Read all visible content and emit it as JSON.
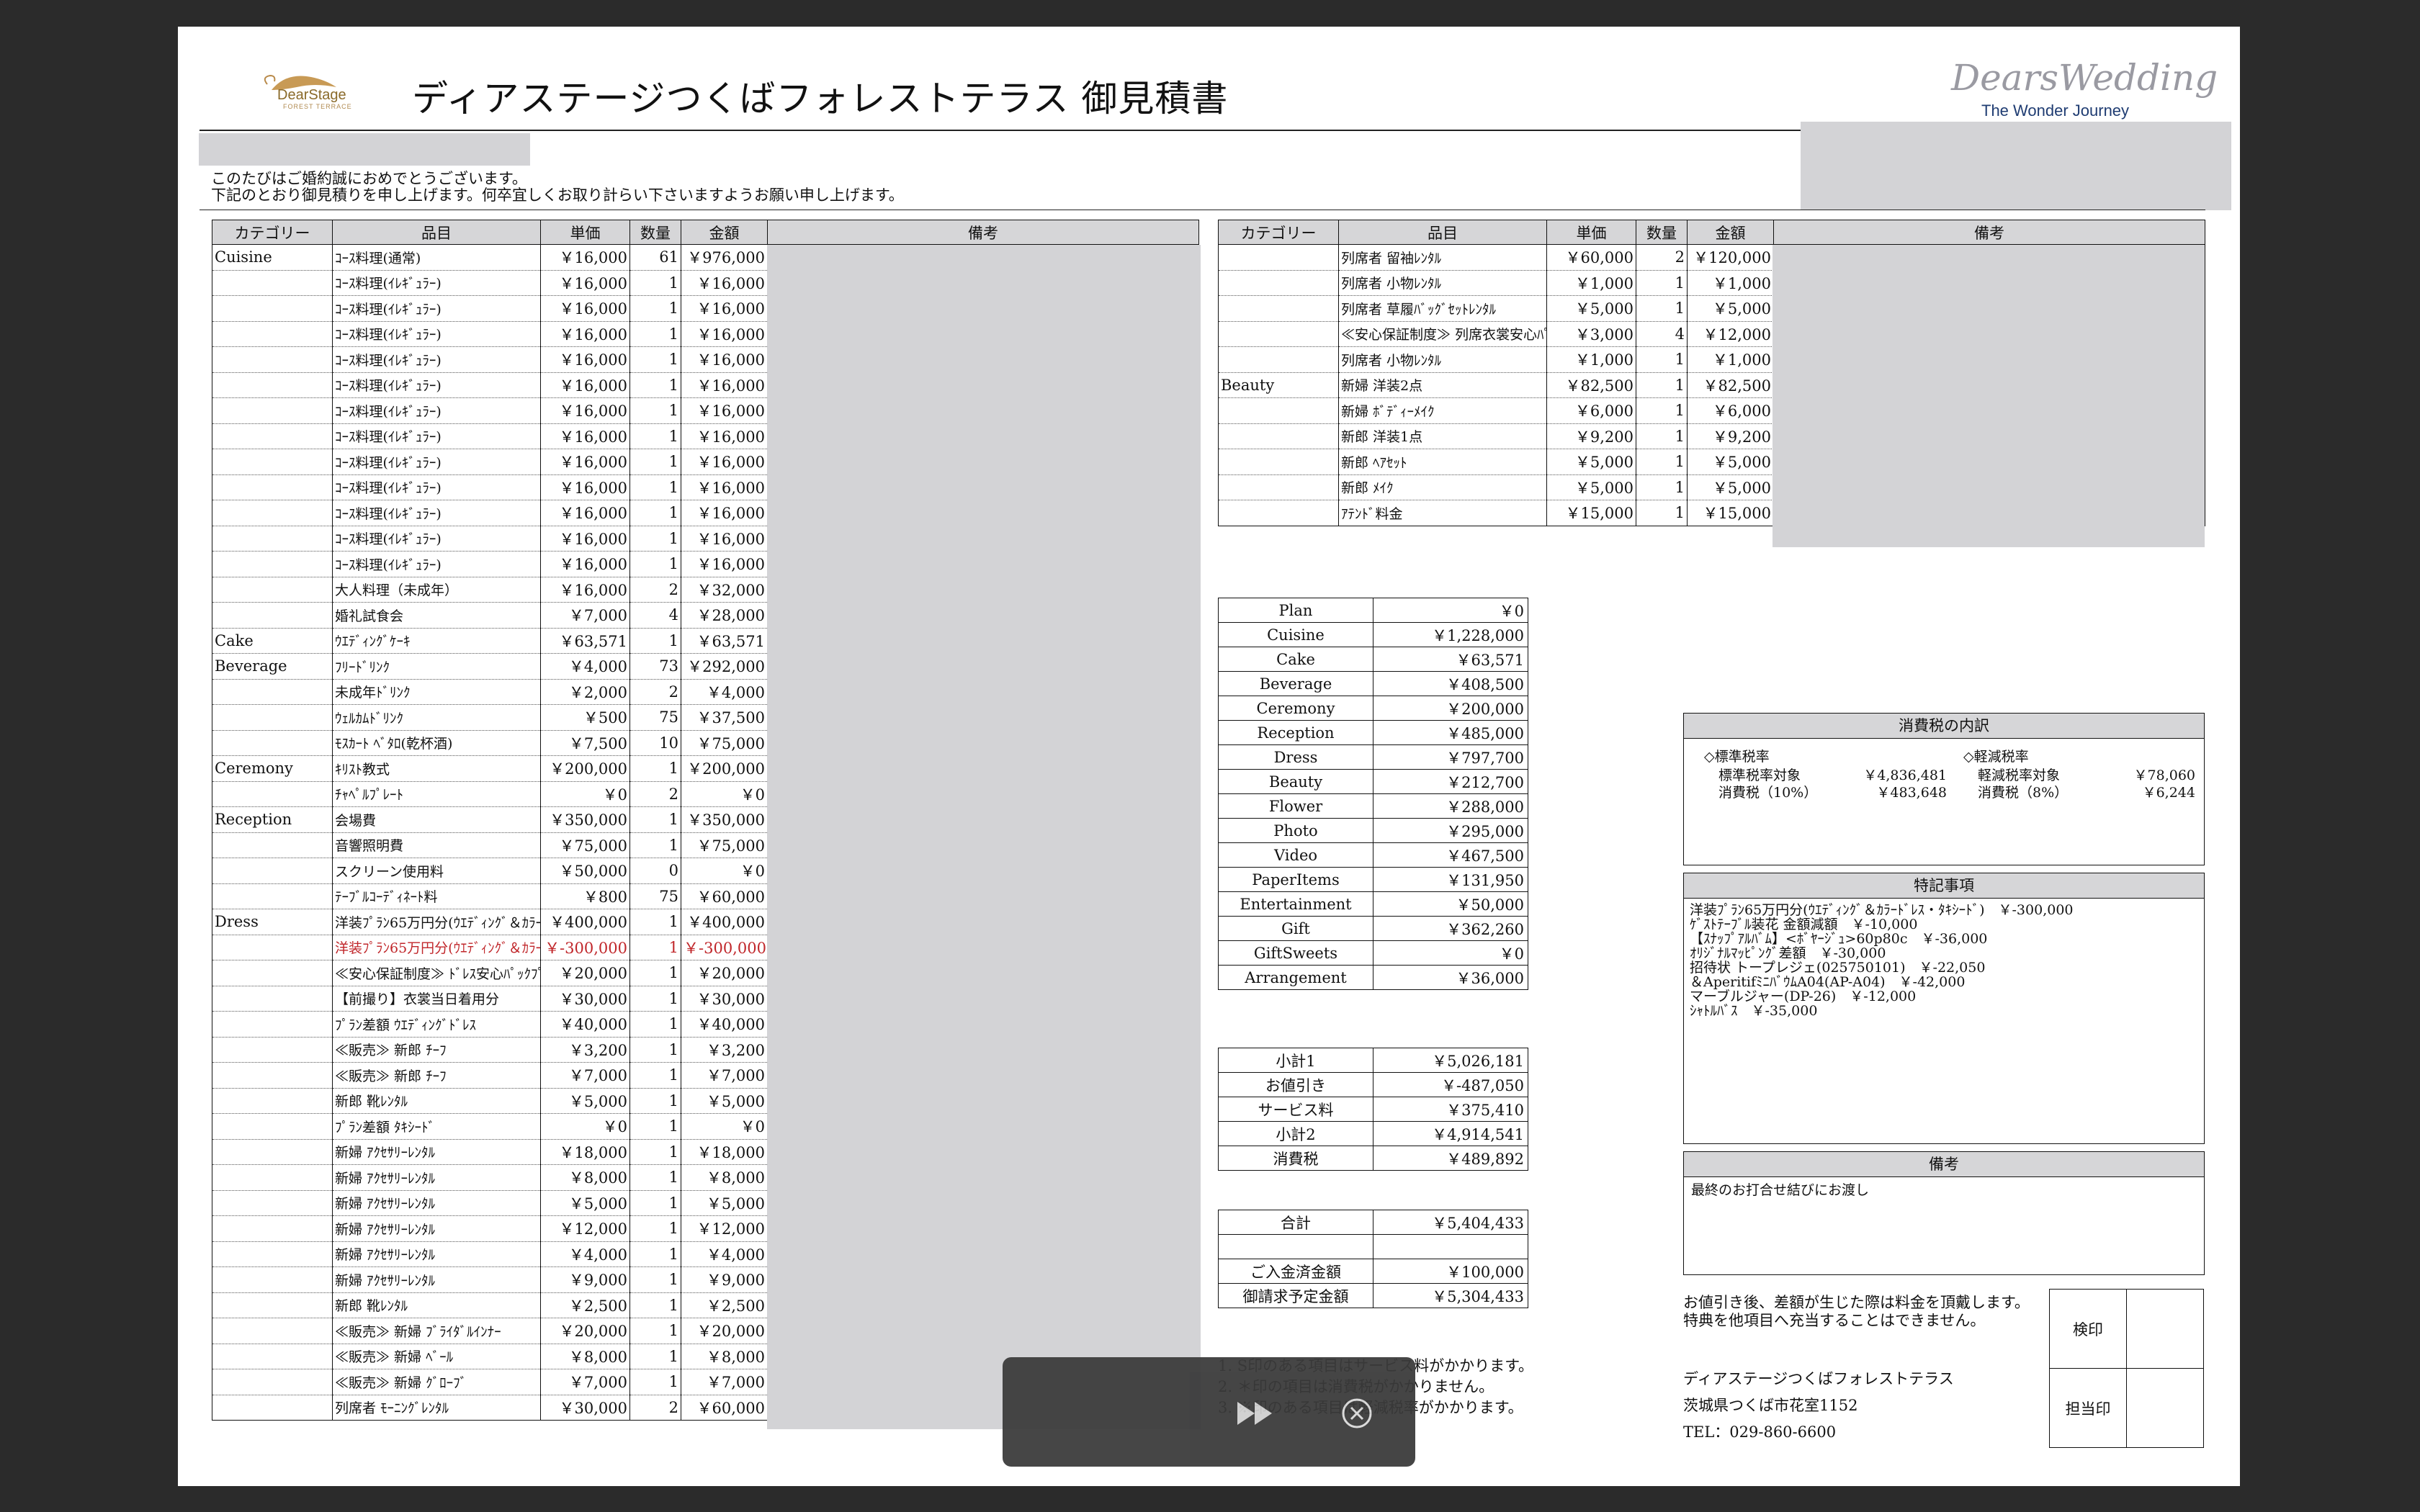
{
  "header": {
    "title": "ディアステージつくばフォレストテラス 御見積書",
    "logo_text": "DearStage",
    "logo_sub": "FOREST TERRACE",
    "brand_main": "DearsWedding",
    "brand_sub": "The Wonder Journey",
    "greeting_1": "このたびはご婚約誠におめでとうございます。",
    "greeting_2": "下記のとおり御見積りを申し上げます。何卒宜しくお取り計らい下さいますようお願い申し上げます。"
  },
  "columns": {
    "category": "カテゴリー",
    "item": "品目",
    "unit": "単価",
    "qty": "数量",
    "amount": "金額",
    "remark": "備考"
  },
  "left_rows": [
    {
      "cat": "Cuisine",
      "item": "ｺｰｽ料理(通常)",
      "unit": "￥16,000",
      "qty": "61",
      "amount": "￥976,000"
    },
    {
      "cat": "",
      "item": "ｺｰｽ料理(ｲﾚｷﾞｭﾗｰ)",
      "unit": "￥16,000",
      "qty": "1",
      "amount": "￥16,000"
    },
    {
      "cat": "",
      "item": "ｺｰｽ料理(ｲﾚｷﾞｭﾗｰ)",
      "unit": "￥16,000",
      "qty": "1",
      "amount": "￥16,000"
    },
    {
      "cat": "",
      "item": "ｺｰｽ料理(ｲﾚｷﾞｭﾗｰ)",
      "unit": "￥16,000",
      "qty": "1",
      "amount": "￥16,000"
    },
    {
      "cat": "",
      "item": "ｺｰｽ料理(ｲﾚｷﾞｭﾗｰ)",
      "unit": "￥16,000",
      "qty": "1",
      "amount": "￥16,000"
    },
    {
      "cat": "",
      "item": "ｺｰｽ料理(ｲﾚｷﾞｭﾗｰ)",
      "unit": "￥16,000",
      "qty": "1",
      "amount": "￥16,000"
    },
    {
      "cat": "",
      "item": "ｺｰｽ料理(ｲﾚｷﾞｭﾗｰ)",
      "unit": "￥16,000",
      "qty": "1",
      "amount": "￥16,000"
    },
    {
      "cat": "",
      "item": "ｺｰｽ料理(ｲﾚｷﾞｭﾗｰ)",
      "unit": "￥16,000",
      "qty": "1",
      "amount": "￥16,000"
    },
    {
      "cat": "",
      "item": "ｺｰｽ料理(ｲﾚｷﾞｭﾗｰ)",
      "unit": "￥16,000",
      "qty": "1",
      "amount": "￥16,000"
    },
    {
      "cat": "",
      "item": "ｺｰｽ料理(ｲﾚｷﾞｭﾗｰ)",
      "unit": "￥16,000",
      "qty": "1",
      "amount": "￥16,000"
    },
    {
      "cat": "",
      "item": "ｺｰｽ料理(ｲﾚｷﾞｭﾗｰ)",
      "unit": "￥16,000",
      "qty": "1",
      "amount": "￥16,000"
    },
    {
      "cat": "",
      "item": "ｺｰｽ料理(ｲﾚｷﾞｭﾗｰ)",
      "unit": "￥16,000",
      "qty": "1",
      "amount": "￥16,000"
    },
    {
      "cat": "",
      "item": "ｺｰｽ料理(ｲﾚｷﾞｭﾗｰ)",
      "unit": "￥16,000",
      "qty": "1",
      "amount": "￥16,000"
    },
    {
      "cat": "",
      "item": "大人料理（未成年）",
      "unit": "￥16,000",
      "qty": "2",
      "amount": "￥32,000"
    },
    {
      "cat": "",
      "item": "婚礼試食会",
      "unit": "￥7,000",
      "qty": "4",
      "amount": "￥28,000"
    },
    {
      "cat": "Cake",
      "item": "ｳｴﾃﾞｨﾝｸﾞｹｰｷ",
      "unit": "￥63,571",
      "qty": "1",
      "amount": "￥63,571"
    },
    {
      "cat": "Beverage",
      "item": "ﾌﾘｰﾄﾞﾘﾝｸ",
      "unit": "￥4,000",
      "qty": "73",
      "amount": "￥292,000"
    },
    {
      "cat": "",
      "item": "未成年ﾄﾞﾘﾝｸ",
      "unit": "￥2,000",
      "qty": "2",
      "amount": "￥4,000"
    },
    {
      "cat": "",
      "item": "ｳｪﾙｶﾑﾄﾞﾘﾝｸ",
      "unit": "￥500",
      "qty": "75",
      "amount": "￥37,500"
    },
    {
      "cat": "",
      "item": "ﾓｽｶｰﾄ ﾍﾞﾀﾛ(乾杯酒)",
      "unit": "￥7,500",
      "qty": "10",
      "amount": "￥75,000"
    },
    {
      "cat": "Ceremony",
      "item": "ｷﾘｽﾄ教式",
      "unit": "￥200,000",
      "qty": "1",
      "amount": "￥200,000"
    },
    {
      "cat": "",
      "item": "ﾁｬﾍﾟﾙﾌﾟﾚｰﾄ",
      "unit": "￥0",
      "qty": "2",
      "amount": "￥0"
    },
    {
      "cat": "Reception",
      "item": "会場費",
      "unit": "￥350,000",
      "qty": "1",
      "amount": "￥350,000"
    },
    {
      "cat": "",
      "item": "音響照明費",
      "unit": "￥75,000",
      "qty": "1",
      "amount": "￥75,000"
    },
    {
      "cat": "",
      "item": "スクリーン使用料",
      "unit": "￥50,000",
      "qty": "0",
      "amount": "￥0"
    },
    {
      "cat": "",
      "item": "ﾃｰﾌﾞﾙｺｰﾃﾞｨﾈｰﾄ料",
      "unit": "￥800",
      "qty": "75",
      "amount": "￥60,000"
    },
    {
      "cat": "Dress",
      "item": "洋装ﾌﾟﾗﾝ65万円分(ｳｴﾃﾞｨﾝｸﾞ＆ｶﾗｰﾄﾞﾚｽ・ﾀｷｼｰﾄﾞ)",
      "unit": "￥400,000",
      "qty": "1",
      "amount": "￥400,000"
    },
    {
      "cat": "",
      "item": "洋装ﾌﾟﾗﾝ65万円分(ｳｴﾃﾞｨﾝｸﾞ＆ｶﾗｰﾄﾞﾚｽ・ﾀｷｼｰﾄﾞ)",
      "unit": "￥-300,000",
      "qty": "1",
      "amount": "￥-300,000",
      "red": true
    },
    {
      "cat": "",
      "item": "≪安心保証制度≫ ﾄﾞﾚｽ安心ﾊﾟｯｸﾌﾟﾗﾝ",
      "unit": "￥20,000",
      "qty": "1",
      "amount": "￥20,000"
    },
    {
      "cat": "",
      "item": "【前撮り】衣裳当日着用分",
      "unit": "￥30,000",
      "qty": "1",
      "amount": "￥30,000"
    },
    {
      "cat": "",
      "item": "ﾌﾟﾗﾝ差額 ｳｴﾃﾞｨﾝｸﾞﾄﾞﾚｽ",
      "unit": "￥40,000",
      "qty": "1",
      "amount": "￥40,000"
    },
    {
      "cat": "",
      "item": "≪販売≫ 新郎 ﾁｰﾌ",
      "unit": "￥3,200",
      "qty": "1",
      "amount": "￥3,200"
    },
    {
      "cat": "",
      "item": "≪販売≫ 新郎 ﾁｰﾌ",
      "unit": "￥7,000",
      "qty": "1",
      "amount": "￥7,000"
    },
    {
      "cat": "",
      "item": "新郎 靴ﾚﾝﾀﾙ",
      "unit": "￥5,000",
      "qty": "1",
      "amount": "￥5,000"
    },
    {
      "cat": "",
      "item": "ﾌﾟﾗﾝ差額 ﾀｷｼｰﾄﾞ",
      "unit": "￥0",
      "qty": "1",
      "amount": "￥0"
    },
    {
      "cat": "",
      "item": "新婦 ｱｸｾｻﾘｰﾚﾝﾀﾙ",
      "unit": "￥18,000",
      "qty": "1",
      "amount": "￥18,000"
    },
    {
      "cat": "",
      "item": "新婦 ｱｸｾｻﾘｰﾚﾝﾀﾙ",
      "unit": "￥8,000",
      "qty": "1",
      "amount": "￥8,000"
    },
    {
      "cat": "",
      "item": "新婦 ｱｸｾｻﾘｰﾚﾝﾀﾙ",
      "unit": "￥5,000",
      "qty": "1",
      "amount": "￥5,000"
    },
    {
      "cat": "",
      "item": "新婦 ｱｸｾｻﾘｰﾚﾝﾀﾙ",
      "unit": "￥12,000",
      "qty": "1",
      "amount": "￥12,000"
    },
    {
      "cat": "",
      "item": "新婦 ｱｸｾｻﾘｰﾚﾝﾀﾙ",
      "unit": "￥4,000",
      "qty": "1",
      "amount": "￥4,000"
    },
    {
      "cat": "",
      "item": "新婦 ｱｸｾｻﾘｰﾚﾝﾀﾙ",
      "unit": "￥9,000",
      "qty": "1",
      "amount": "￥9,000"
    },
    {
      "cat": "",
      "item": "新郎 靴ﾚﾝﾀﾙ",
      "unit": "￥2,500",
      "qty": "1",
      "amount": "￥2,500"
    },
    {
      "cat": "",
      "item": "≪販売≫ 新婦 ﾌﾞﾗｲﾀﾞﾙｲﾝﾅｰ",
      "unit": "￥20,000",
      "qty": "1",
      "amount": "￥20,000"
    },
    {
      "cat": "",
      "item": "≪販売≫ 新婦 ﾍﾞｰﾙ",
      "unit": "￥8,000",
      "qty": "1",
      "amount": "￥8,000"
    },
    {
      "cat": "",
      "item": "≪販売≫ 新婦 ｸﾞﾛｰﾌﾞ",
      "unit": "￥7,000",
      "qty": "1",
      "amount": "￥7,000"
    },
    {
      "cat": "",
      "item": "列席者 ﾓｰﾆﾝｸﾞﾚﾝﾀﾙ",
      "unit": "￥30,000",
      "qty": "2",
      "amount": "￥60,000"
    }
  ],
  "right_rows": [
    {
      "cat": "",
      "item": "列席者 留袖ﾚﾝﾀﾙ",
      "unit": "￥60,000",
      "qty": "2",
      "amount": "￥120,000"
    },
    {
      "cat": "",
      "item": "列席者 小物ﾚﾝﾀﾙ",
      "unit": "￥1,000",
      "qty": "1",
      "amount": "￥1,000"
    },
    {
      "cat": "",
      "item": "列席者 草履ﾊﾞｯｸﾞｾｯﾄﾚﾝﾀﾙ",
      "unit": "￥5,000",
      "qty": "1",
      "amount": "￥5,000"
    },
    {
      "cat": "",
      "item": "≪安心保証制度≫ 列席衣裳安心ﾊﾟｯｸ",
      "unit": "￥3,000",
      "qty": "4",
      "amount": "￥12,000"
    },
    {
      "cat": "",
      "item": "列席者 小物ﾚﾝﾀﾙ",
      "unit": "￥1,000",
      "qty": "1",
      "amount": "￥1,000"
    },
    {
      "cat": "Beauty",
      "item": "新婦 洋装2点",
      "unit": "￥82,500",
      "qty": "1",
      "amount": "￥82,500"
    },
    {
      "cat": "",
      "item": "新婦 ﾎﾞﾃﾞｨｰﾒｲｸ",
      "unit": "￥6,000",
      "qty": "1",
      "amount": "￥6,000"
    },
    {
      "cat": "",
      "item": "新郎 洋装1点",
      "unit": "￥9,200",
      "qty": "1",
      "amount": "￥9,200"
    },
    {
      "cat": "",
      "item": "新郎 ﾍｱｾｯﾄ",
      "unit": "￥5,000",
      "qty": "1",
      "amount": "￥5,000"
    },
    {
      "cat": "",
      "item": "新郎 ﾒｲｸ",
      "unit": "￥5,000",
      "qty": "1",
      "amount": "￥5,000"
    },
    {
      "cat": "",
      "item": "ｱﾃﾝﾄﾞ料金",
      "unit": "￥15,000",
      "qty": "1",
      "amount": "￥15,000"
    }
  ],
  "category_totals": [
    {
      "k": "Plan",
      "v": "￥0"
    },
    {
      "k": "Cuisine",
      "v": "￥1,228,000"
    },
    {
      "k": "Cake",
      "v": "￥63,571"
    },
    {
      "k": "Beverage",
      "v": "￥408,500"
    },
    {
      "k": "Ceremony",
      "v": "￥200,000"
    },
    {
      "k": "Reception",
      "v": "￥485,000"
    },
    {
      "k": "Dress",
      "v": "￥797,700"
    },
    {
      "k": "Beauty",
      "v": "￥212,700"
    },
    {
      "k": "Flower",
      "v": "￥288,000"
    },
    {
      "k": "Photo",
      "v": "￥295,000"
    },
    {
      "k": "Video",
      "v": "￥467,500"
    },
    {
      "k": "PaperItems",
      "v": "￥131,950"
    },
    {
      "k": "Entertainment",
      "v": "￥50,000"
    },
    {
      "k": "Gift",
      "v": "￥362,260"
    },
    {
      "k": "GiftSweets",
      "v": "￥0"
    },
    {
      "k": "Arrangement",
      "v": "￥36,000"
    }
  ],
  "subtotals": [
    {
      "k": "小計1",
      "v": "￥5,026,181"
    },
    {
      "k": "お値引き",
      "v": "￥-487,050"
    },
    {
      "k": "サービス料",
      "v": "￥375,410"
    },
    {
      "k": "小計2",
      "v": "￥4,914,541"
    },
    {
      "k": "消費税",
      "v": "￥489,892"
    }
  ],
  "totals": [
    {
      "k": "合計",
      "v": "￥5,404,433"
    },
    {
      "k": "",
      "v": ""
    },
    {
      "k": "ご入金済金額",
      "v": "￥100,000"
    },
    {
      "k": "御請求予定金額",
      "v": "￥5,304,433"
    }
  ],
  "footnotes": [
    "1. S印のある項目はサービス料がかかります。",
    "2. ＊印の項目は消費税がかかりません。",
    "3. ※印のある項目は軽減税率がかかります。"
  ],
  "tax": {
    "title": "消費税の内訳",
    "std_head": "◇標準税率",
    "std_target_label": "標準税率対象",
    "std_target": "￥4,836,481",
    "std_tax_label": "消費税（10%）",
    "std_tax": "￥483,648",
    "red_head": "◇軽減税率",
    "red_target_label": "軽減税率対象",
    "red_target": "￥78,060",
    "red_tax_label": "消費税（8%）",
    "red_tax": "￥6,244"
  },
  "special": {
    "title": "特記事項",
    "lines": [
      "洋装ﾌﾟﾗﾝ65万円分(ｳｴﾃﾞｨﾝｸﾞ＆ｶﾗｰﾄﾞﾚｽ・ﾀｷｼｰﾄﾞ)　￥-300,000",
      "ｹﾞｽﾄﾃｰﾌﾞﾙ装花 金額減額　￥-10,000",
      "【ｽﾅｯﾌﾟｱﾙﾊﾞﾑ】<ﾎﾞﾔｰｼﾞｭ>60p80c　￥-36,000",
      "ｵﾘｼﾞﾅﾙﾏｯﾋﾟﾝｸﾞ差額　￥-30,000",
      "招待状 トープレジェ(025750101)　￥-22,050",
      "＆AperitifﾐﾆﾊﾞｳﾑA04(AP-A04)　￥-42,000",
      "マーブルジャー(DP-26)　￥-12,000",
      "ｼｬﾄﾙﾊﾞｽ　￥-35,000"
    ]
  },
  "bikou": {
    "title": "備考",
    "text": "最終のお打合せ結びにお渡し"
  },
  "notice": {
    "line1": "お値引き後、差額が生じた際は料金を頂戴します。",
    "line2": "特典を他項目へ充当することはできません。"
  },
  "venue": {
    "name": "ディアステージつくばフォレストテラス",
    "address": "茨城県つくば市花室1152",
    "tel": "TEL：029-860-6600"
  },
  "stamps": {
    "inspect": "検印",
    "person": "担当印"
  },
  "overlay": {
    "play_icon": "fast-forward",
    "close_icon": "close-circle"
  }
}
